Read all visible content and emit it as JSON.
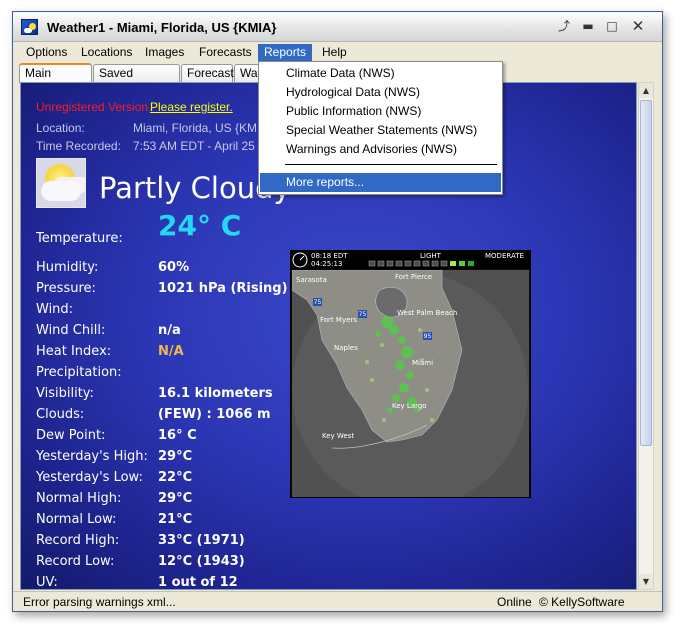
{
  "window": {
    "title": "Weather1 - Miami, Florida, US {KMIA}"
  },
  "menu": {
    "items": [
      "Options",
      "Locations",
      "Images",
      "Forecasts",
      "Reports",
      "Help"
    ],
    "active": "Reports"
  },
  "tabs": [
    "Main location",
    "Saved locations",
    "Forecast",
    "Wa"
  ],
  "banner": {
    "unregistered": "Unregistered Version.",
    "register_link": "Please register."
  },
  "location": {
    "label": "Location:",
    "value": "Miami, Florida, US {KMIA}"
  },
  "time_recorded": {
    "label": "Time Recorded:",
    "value": "7:53 AM EDT - April 25"
  },
  "condition": "Partly Cloudy",
  "observations": [
    {
      "label": "Temperature:",
      "value": "24° C"
    },
    {
      "label": "Humidity:",
      "value": "60%"
    },
    {
      "label": "Pressure:",
      "value": "1021 hPa (Rising)"
    },
    {
      "label": "Wind:",
      "value": ""
    },
    {
      "label": "Wind Chill:",
      "value": "n/a"
    },
    {
      "label": "Heat Index:",
      "value": "N/A"
    },
    {
      "label": "Precipitation:",
      "value": ""
    },
    {
      "label": "Visibility:",
      "value": "16.1 kilometers"
    },
    {
      "label": "Clouds:",
      "value": "(FEW) : 1066 m"
    },
    {
      "label": "Dew Point:",
      "value": "16° C"
    },
    {
      "label": "Yesterday's High:",
      "value": "29°C"
    },
    {
      "label": "Yesterday's Low:",
      "value": "22°C"
    },
    {
      "label": "Normal High:",
      "value": "29°C"
    },
    {
      "label": "Normal Low:",
      "value": "21°C"
    },
    {
      "label": "Record High:",
      "value": "33°C (1971)"
    },
    {
      "label": "Record Low:",
      "value": "12°C (1943)"
    },
    {
      "label": "UV:",
      "value": "1 out of 12"
    }
  ],
  "radar": {
    "time1": "08:18 EDT",
    "time2": "04:25:13",
    "scale_low": "LIGHT",
    "scale_high": "MODERATE",
    "places": [
      "Sarasota",
      "Fort Pierce",
      "Fort Myers",
      "West Palm Beach",
      "Naples",
      "Miami",
      "Key Largo",
      "Key West"
    ],
    "highways": [
      "75",
      "75",
      "95"
    ]
  },
  "reports_menu": {
    "items": [
      "Climate Data (NWS)",
      "Hydrological Data (NWS)",
      "Public Information (NWS)",
      "Special Weather Statements (NWS)",
      "Warnings and Advisories (NWS)"
    ],
    "more": "More reports..."
  },
  "status": {
    "message": "Error parsing warnings xml...",
    "online": "Online",
    "copyright": "© KellySoftware"
  },
  "colors": {
    "content_bg": "#2b36b4",
    "temperature": "#23d8f2",
    "heat_index": "#f2b84a",
    "unregistered": "#ff1c1c",
    "register_link": "#ffff00",
    "menu_highlight": "#316ac5"
  }
}
